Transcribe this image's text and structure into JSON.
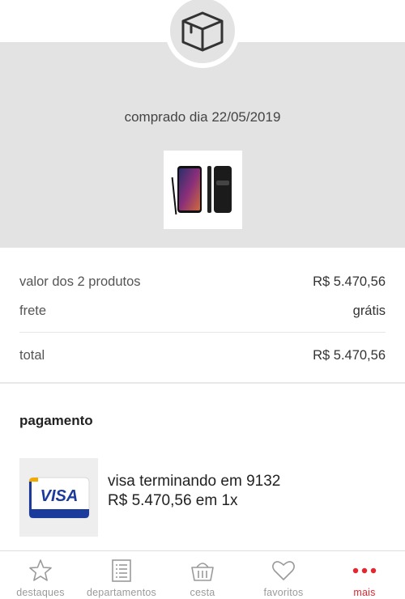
{
  "order": {
    "purchase_date": "comprado dia 22/05/2019"
  },
  "summary": {
    "products_label": "valor dos 2 produtos",
    "products_value": "R$ 5.470,56",
    "shipping_label": "frete",
    "shipping_value": "grátis",
    "total_label": "total",
    "total_value": "R$ 5.470,56"
  },
  "payment": {
    "title": "pagamento",
    "card_brand": "VISA",
    "card_line": "visa terminando em 9132",
    "installments_line": "R$ 5.470,56 em 1x"
  },
  "tabbar": {
    "items": [
      {
        "label": "destaques",
        "icon": "star-icon"
      },
      {
        "label": "departamentos",
        "icon": "list-icon"
      },
      {
        "label": "cesta",
        "icon": "basket-icon"
      },
      {
        "label": "favoritos",
        "icon": "heart-icon"
      },
      {
        "label": "mais",
        "icon": "more-icon",
        "active": true
      }
    ]
  },
  "colors": {
    "accent": "#e3262f",
    "header_gray": "#e3e3e3",
    "visa_blue": "#1a3a9c",
    "visa_gold": "#f2a900"
  }
}
